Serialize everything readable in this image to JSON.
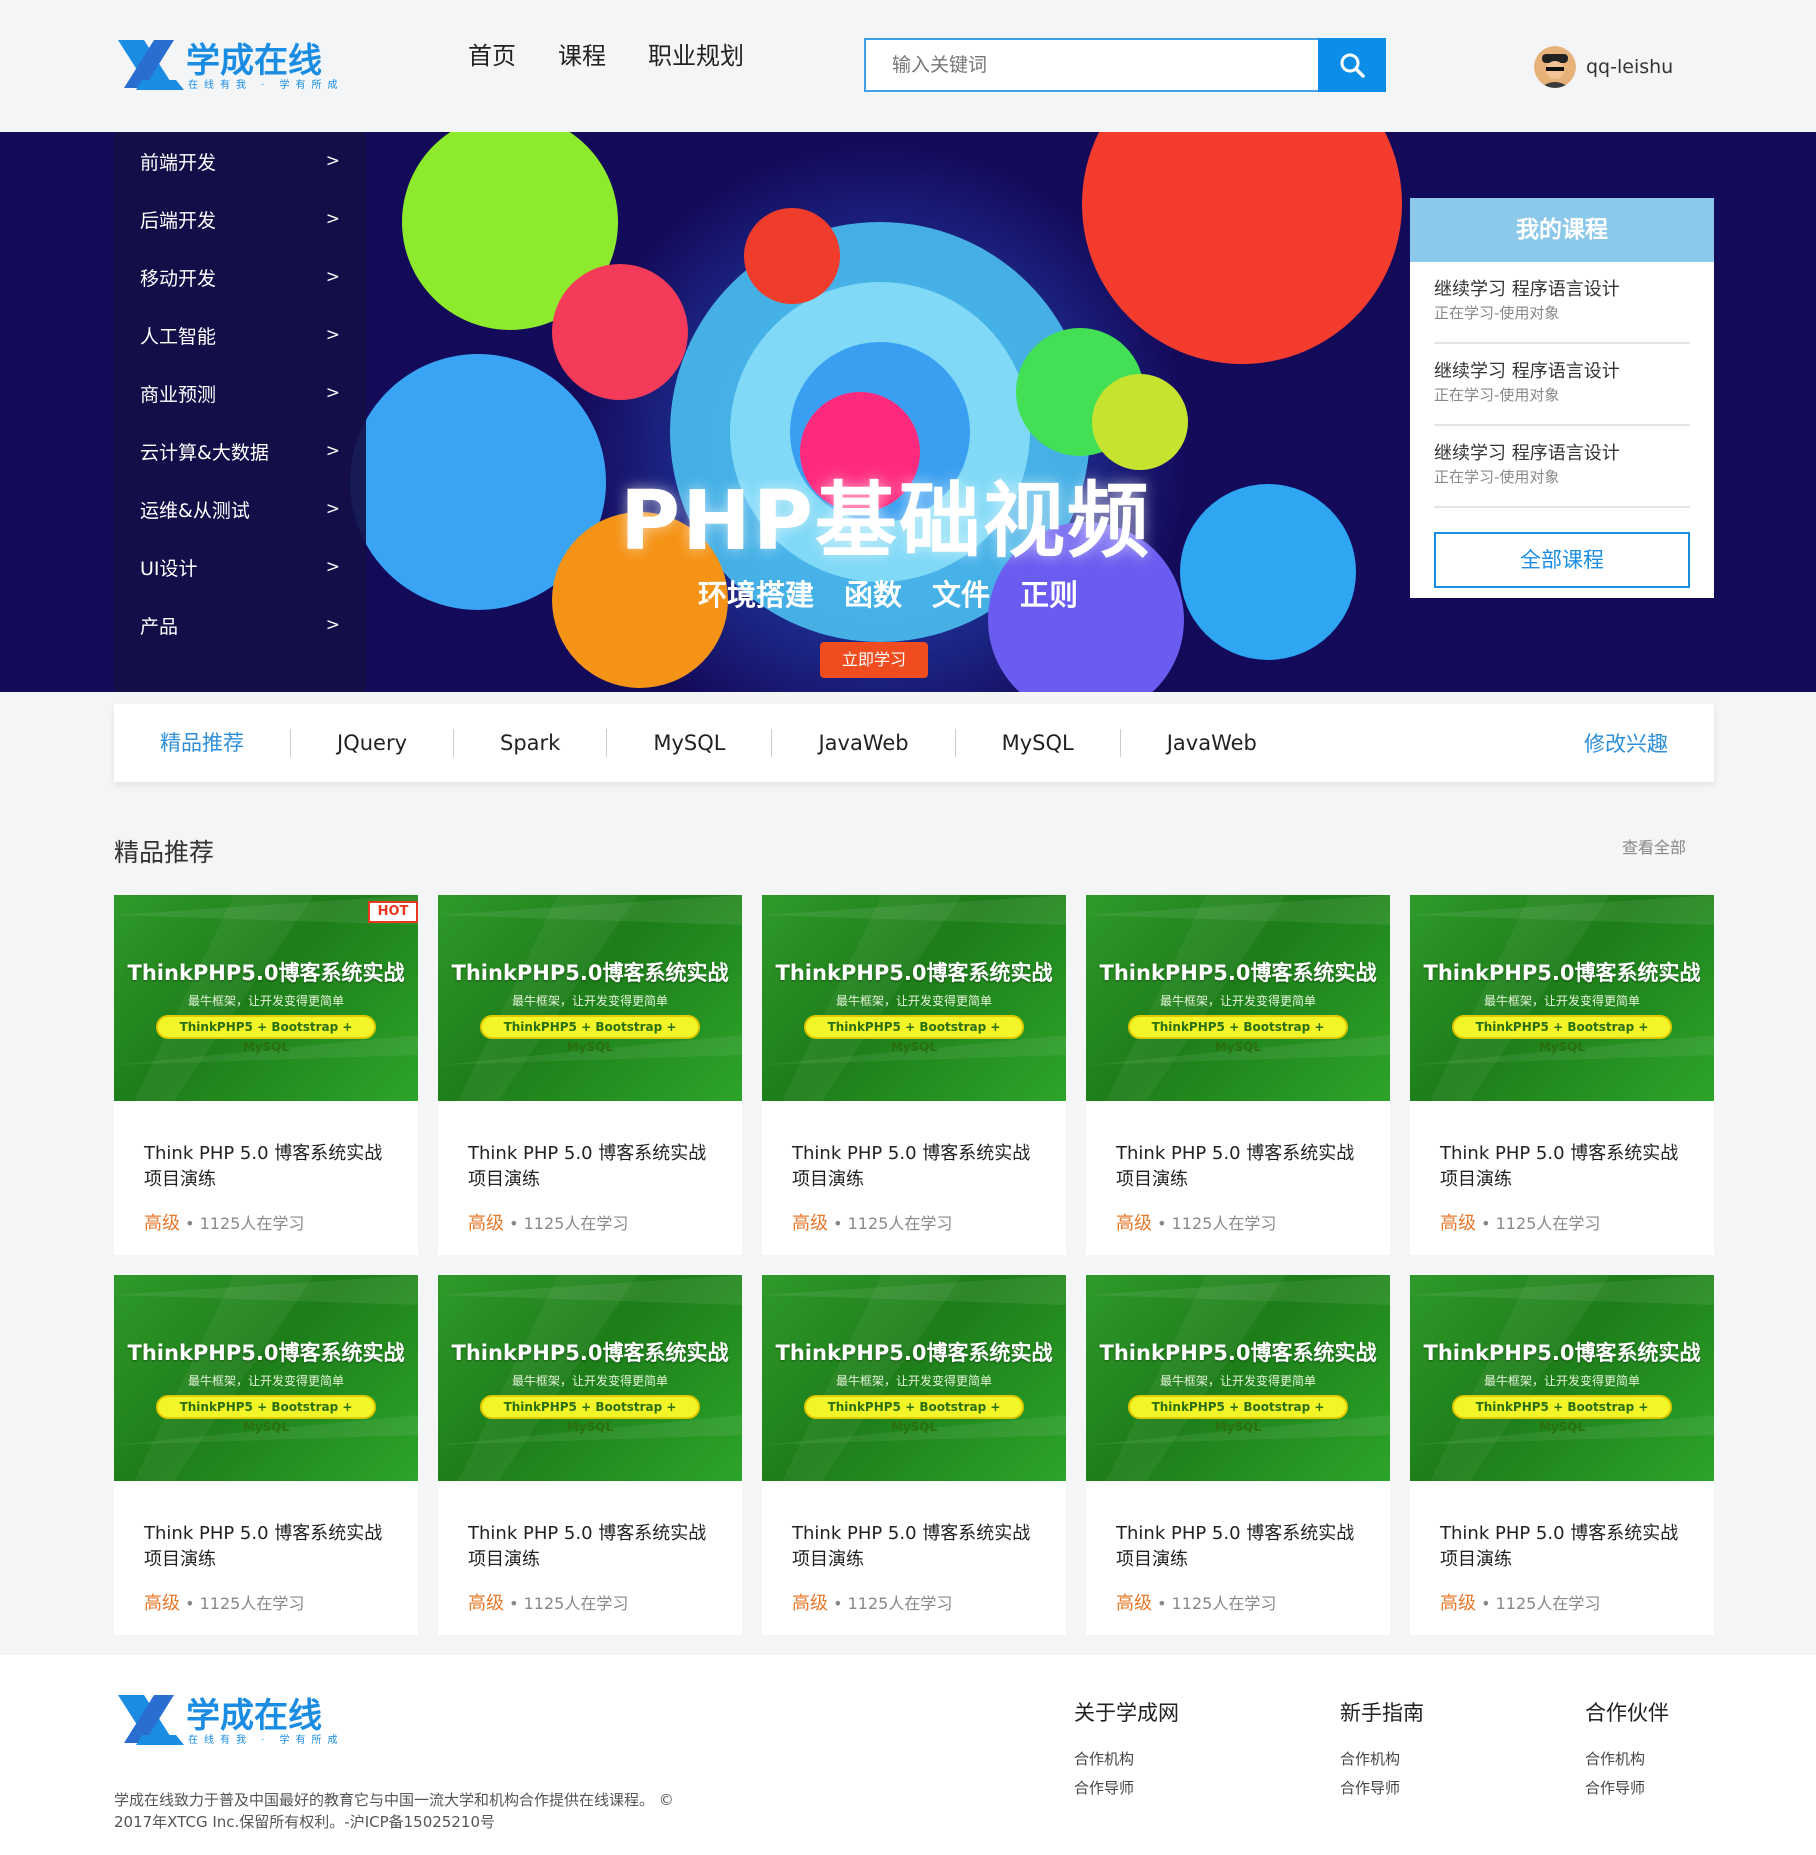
{
  "brand": {
    "name": "学成在线",
    "slogan": "在线有我 · 学有所成",
    "colors": {
      "primary": "#0c8ee8",
      "accent": "#2f8fd8",
      "level": "#e8792b",
      "banner_bg": "#140a5a"
    }
  },
  "header": {
    "nav": [
      "首页",
      "课程",
      "职业规划"
    ],
    "search": {
      "placeholder": "输入关键词",
      "icon": "search-icon"
    },
    "user": {
      "name": "qq-leishu"
    }
  },
  "sidebar": {
    "items": [
      {
        "label": "前端开发",
        "arrow": ">"
      },
      {
        "label": "后端开发",
        "arrow": ">"
      },
      {
        "label": "移动开发",
        "arrow": ">"
      },
      {
        "label": "人工智能",
        "arrow": ">"
      },
      {
        "label": "商业预测",
        "arrow": ">"
      },
      {
        "label": "云计算&大数据",
        "arrow": ">"
      },
      {
        "label": "运维&从测试",
        "arrow": ">"
      },
      {
        "label": "UI设计",
        "arrow": ">"
      },
      {
        "label": "产品",
        "arrow": ">"
      }
    ]
  },
  "banner": {
    "title": "PHP基础视频",
    "subtitle": [
      "环境搭建",
      "函数",
      "文件",
      "正则"
    ],
    "button": "立即学习"
  },
  "my_courses": {
    "title": "我的课程",
    "items": [
      {
        "title": "继续学习 程序语言设计",
        "sub": "正在学习-使用对象"
      },
      {
        "title": "继续学习 程序语言设计",
        "sub": "正在学习-使用对象"
      },
      {
        "title": "继续学习 程序语言设计",
        "sub": "正在学习-使用对象"
      }
    ],
    "all_button": "全部课程"
  },
  "tabs": {
    "items": [
      "精品推荐",
      "JQuery",
      "Spark",
      "MySQL",
      "JavaWeb",
      "MySQL",
      "JavaWeb"
    ],
    "edit": "修改兴趣"
  },
  "section": {
    "title": "精品推荐",
    "more": "查看全部"
  },
  "course_thumb": {
    "big": "ThinkPHP5.0博客系统实战",
    "small": "最牛框架，让开发变得更简单",
    "pill": "ThinkPHP5 + Bootstrap + MySQL",
    "hot": "HOT"
  },
  "courses": [
    {
      "title": "Think PHP 5.0 博客系统实战项目演练",
      "level": "高级",
      "learners": "1125人在学习",
      "hot": true
    },
    {
      "title": "Think PHP 5.0 博客系统实战项目演练",
      "level": "高级",
      "learners": "1125人在学习",
      "hot": false
    },
    {
      "title": "Think PHP 5.0 博客系统实战项目演练",
      "level": "高级",
      "learners": "1125人在学习",
      "hot": false
    },
    {
      "title": "Think PHP 5.0 博客系统实战项目演练",
      "level": "高级",
      "learners": "1125人在学习",
      "hot": false
    },
    {
      "title": "Think PHP 5.0 博客系统实战项目演练",
      "level": "高级",
      "learners": "1125人在学习",
      "hot": false
    },
    {
      "title": "Think PHP 5.0 博客系统实战项目演练",
      "level": "高级",
      "learners": "1125人在学习",
      "hot": false
    },
    {
      "title": "Think PHP 5.0 博客系统实战项目演练",
      "level": "高级",
      "learners": "1125人在学习",
      "hot": false
    },
    {
      "title": "Think PHP 5.0 博客系统实战项目演练",
      "level": "高级",
      "learners": "1125人在学习",
      "hot": false
    },
    {
      "title": "Think PHP 5.0 博客系统实战项目演练",
      "level": "高级",
      "learners": "1125人在学习",
      "hot": false
    },
    {
      "title": "Think PHP 5.0 博客系统实战项目演练",
      "level": "高级",
      "learners": "1125人在学习",
      "hot": false
    }
  ],
  "footer": {
    "desc": "学成在线致力于普及中国最好的教育它与中国一流大学和机构合作提供在线课程。 © 2017年XTCG Inc.保留所有权利。-沪ICP备15025210号",
    "columns": [
      {
        "title": "关于学成网",
        "links": [
          "合作机构",
          "合作导师"
        ]
      },
      {
        "title": "新手指南",
        "links": [
          "合作机构",
          "合作导师"
        ]
      },
      {
        "title": "合作伙伴",
        "links": [
          "合作机构",
          "合作导师"
        ]
      }
    ]
  }
}
